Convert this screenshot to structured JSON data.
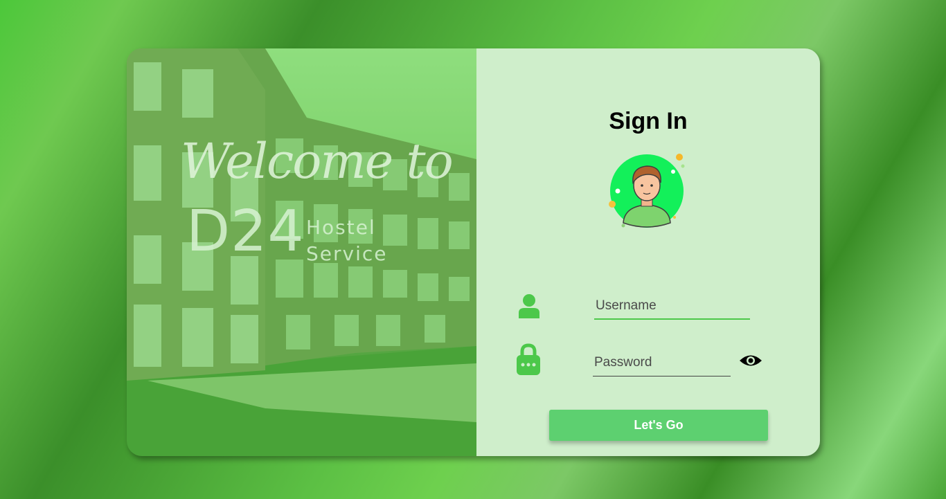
{
  "hero": {
    "welcome_text": "Welcome to",
    "brand_big": "D24",
    "brand_small_line1": "Hostel",
    "brand_small_line2": "Service"
  },
  "form": {
    "title": "Sign In",
    "username": {
      "placeholder": "Username",
      "value": ""
    },
    "password": {
      "placeholder": "Password",
      "value": ""
    },
    "submit_label": "Let's Go"
  },
  "icons": {
    "user": "user-icon",
    "lock": "lock-icon",
    "eye": "eye-icon",
    "avatar": "avatar-illustration"
  },
  "colors": {
    "accent": "#5dd070",
    "icon_green": "#4cc84a",
    "panel": "#cfeecb",
    "avatar_bg": "#13f05a"
  }
}
